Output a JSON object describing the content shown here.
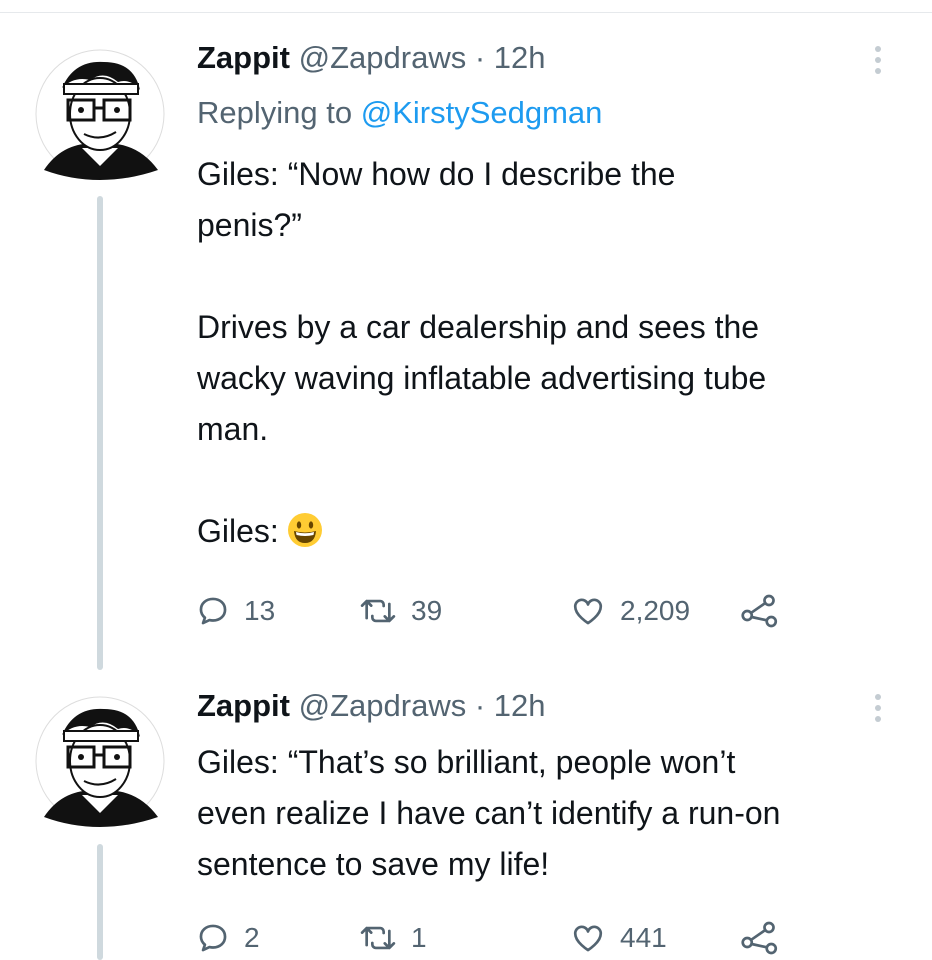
{
  "tweets": [
    {
      "name": "Zappit",
      "handle": "@Zapdraws",
      "sep": " · ",
      "time": "12h",
      "replying_prefix": "Replying to ",
      "replying_to": "@KirstySedgman",
      "lines": [
        "Giles: “Now how do I describe the",
        "penis?”",
        "Drives by a car dealership and sees the",
        "wacky waving inflatable advertising tube",
        "man.",
        "Giles:"
      ],
      "emoji": "grinning-face",
      "replies": "13",
      "retweets": "39",
      "likes": "2,209"
    },
    {
      "name": "Zappit",
      "handle": "@Zapdraws",
      "sep": " · ",
      "time": "12h",
      "lines": [
        "Giles: “That’s so brilliant, people won’t",
        "even realize I have can’t identify a run-on",
        "sentence to save my life!"
      ],
      "replies": "2",
      "retweets": "1",
      "likes": "441"
    }
  ],
  "colors": {
    "text": "#0f1419",
    "secondary": "#536471",
    "link": "#1d9bf0",
    "thread": "#cfd9de",
    "emoji": "#ffcc33"
  }
}
